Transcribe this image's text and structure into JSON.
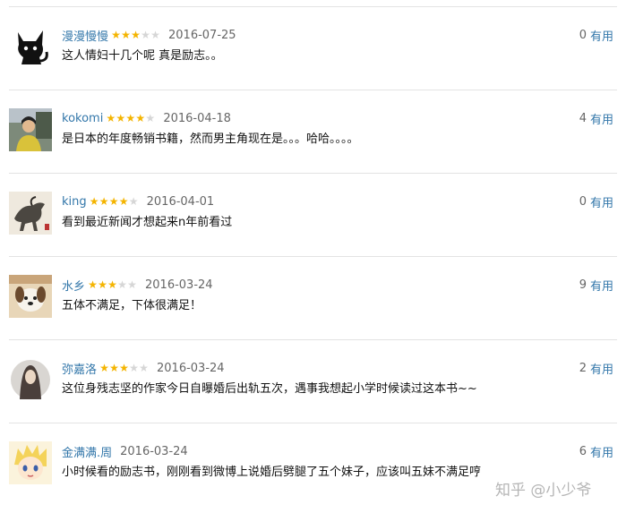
{
  "reviews": [
    {
      "username": "漫漫慢慢",
      "rating": 3,
      "date": "2016-07-25",
      "content": "这人情妇十几个呢 真是励志。。",
      "useful_count": "0",
      "useful_label": "有用"
    },
    {
      "username": "kokomi",
      "rating": 4,
      "date": "2016-04-18",
      "content": "是日本的年度畅销书籍，然而男主角现在是。。。哈哈。。。。",
      "useful_count": "4",
      "useful_label": "有用"
    },
    {
      "username": "king",
      "rating": 4,
      "date": "2016-04-01",
      "content": "看到最近新闻才想起来n年前看过",
      "useful_count": "0",
      "useful_label": "有用"
    },
    {
      "username": "水乡",
      "rating": 3,
      "date": "2016-03-24",
      "content": "五体不满足，下体很满足！",
      "useful_count": "9",
      "useful_label": "有用"
    },
    {
      "username": "弥嘉洛",
      "rating": 3,
      "date": "2016-03-24",
      "content": "这位身残志坚的作家今日自曝婚后出轨五次，遇事我想起小学时候读过这本书~~",
      "useful_count": "2",
      "useful_label": "有用"
    },
    {
      "username": "金满满.周",
      "rating": null,
      "date": "2016-03-24",
      "content": "小时候看的励志书，刚刚看到微博上说婚后劈腿了五个妹子，应该叫五妹不满足哼",
      "useful_count": "6",
      "useful_label": "有用"
    }
  ],
  "watermark": "知乎 @小少爷",
  "colors": {
    "link": "#3377aa",
    "star_on": "#f4b400",
    "star_off": "#d6d6d6",
    "divider": "#e3e3e3"
  }
}
